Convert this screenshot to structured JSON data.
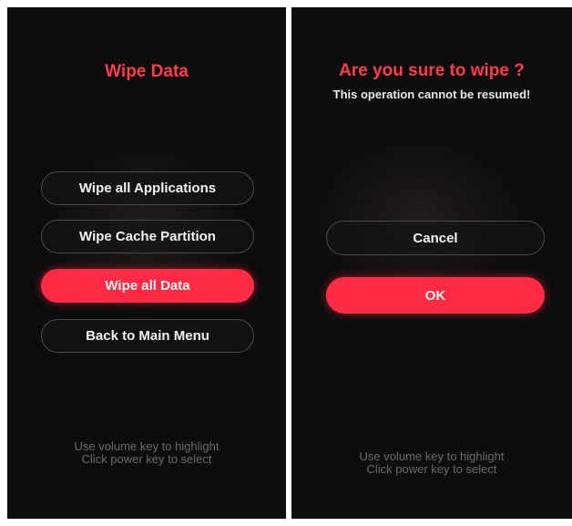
{
  "left": {
    "title": "Wipe Data",
    "menu": [
      {
        "label": "Wipe all Applications",
        "highlighted": false
      },
      {
        "label": "Wipe Cache Partition",
        "highlighted": false
      },
      {
        "label": "Wipe all Data",
        "highlighted": true
      },
      {
        "label": "Back to Main Menu",
        "highlighted": false
      }
    ],
    "hint_line1": "Use volume key to highlight",
    "hint_line2": "Click power key to select"
  },
  "right": {
    "title": "Are you sure to wipe ?",
    "subtitle": "This operation cannot be resumed!",
    "cancel_label": "Cancel",
    "ok_label": "OK",
    "highlighted": "OK",
    "hint_line1": "Use volume key to highlight",
    "hint_line2": "Click power key to select"
  },
  "colors": {
    "accent": "#ff2a44",
    "title_red": "#ff3b4b",
    "background": "#0d0d0d",
    "hint_gray": "#6a6a6a"
  }
}
